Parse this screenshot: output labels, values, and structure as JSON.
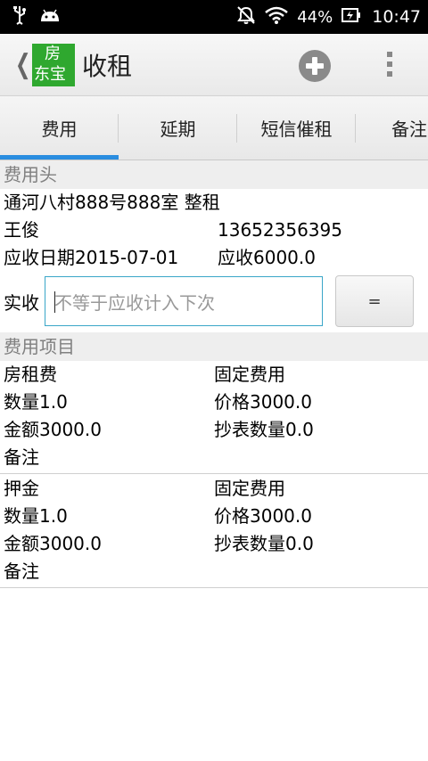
{
  "status_bar": {
    "battery_pct": "44%",
    "time": "10:47",
    "icons": [
      "usb-icon",
      "android-icon",
      "mute-icon",
      "wifi-icon",
      "battery-icon"
    ]
  },
  "action_bar": {
    "logo_top": "房",
    "logo_bottom": "东宝",
    "title": "收租"
  },
  "tabs": [
    {
      "label": "费用"
    },
    {
      "label": "延期"
    },
    {
      "label": "短信催租"
    },
    {
      "label": "备注"
    }
  ],
  "fee_head": {
    "section_title": "费用头",
    "address": "通河八村888号888室 整租",
    "tenant_name": "王俊",
    "tenant_phone": "13652356395",
    "due_date": "应收日期2015-07-01",
    "due_amount": "应收6000.0",
    "collected_label": "实收",
    "collected_placeholder": "不等于应收计入下次",
    "equals_button": "="
  },
  "fee_items": {
    "section_title": "费用项目",
    "items": [
      {
        "name": "房租费",
        "type": "固定费用",
        "quantity": "数量1.0",
        "price": "价格3000.0",
        "amount": "金额3000.0",
        "meter": "抄表数量0.0",
        "remark": "备注"
      },
      {
        "name": "押金",
        "type": "固定费用",
        "quantity": "数量1.0",
        "price": "价格3000.0",
        "amount": "金额3000.0",
        "meter": "抄表数量0.0",
        "remark": "备注"
      }
    ]
  },
  "colors": {
    "accent": "#2a8de0",
    "logo_bg": "#2fa82f",
    "input_border": "#3aa6c8"
  }
}
